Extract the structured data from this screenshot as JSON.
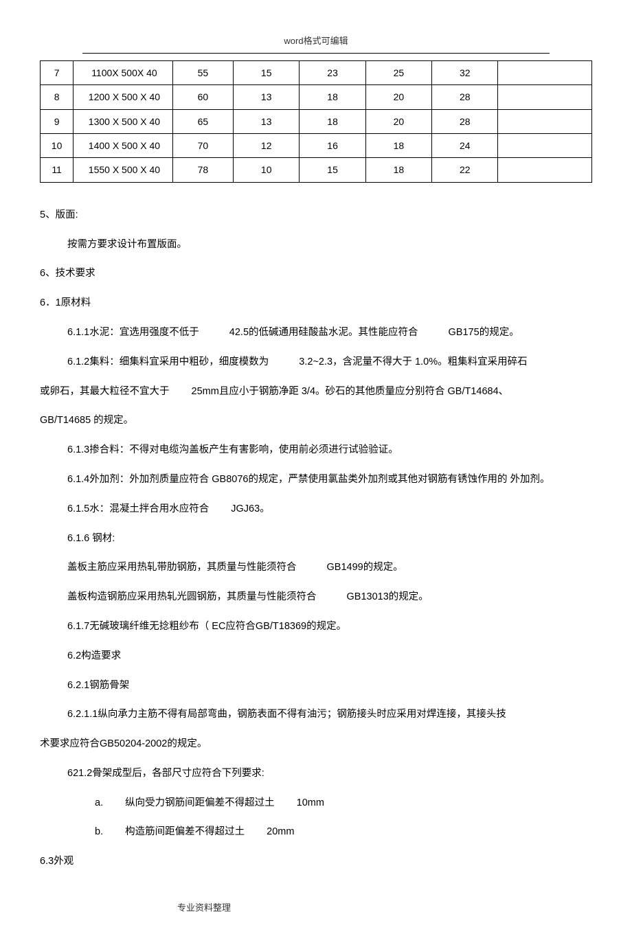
{
  "header": "word格式可编辑",
  "footer": "专业资料整理",
  "chart_data": {
    "type": "table",
    "rows": [
      {
        "idx": "7",
        "dim": "1100X 500X 40",
        "c3": "55",
        "c4": "15",
        "c5": "23",
        "c6": "25",
        "c7": "32",
        "c8": ""
      },
      {
        "idx": "8",
        "dim": "1200 X 500 X 40",
        "c3": "60",
        "c4": "13",
        "c5": "18",
        "c6": "20",
        "c7": "28",
        "c8": ""
      },
      {
        "idx": "9",
        "dim": "1300 X 500 X 40",
        "c3": "65",
        "c4": "13",
        "c5": "18",
        "c6": "20",
        "c7": "28",
        "c8": ""
      },
      {
        "idx": "10",
        "dim": "1400 X 500 X 40",
        "c3": "70",
        "c4": "12",
        "c5": "16",
        "c6": "18",
        "c7": "24",
        "c8": ""
      },
      {
        "idx": "11",
        "dim": "1550 X 500 X 40",
        "c3": "78",
        "c4": "10",
        "c5": "15",
        "c6": "18",
        "c7": "22",
        "c8": ""
      }
    ]
  },
  "sections": {
    "s5_title": "5、版面:",
    "s5_p1": "按需方要求设计布置版面。",
    "s6_title": "6、技术要求",
    "s6_1_title": "6．1原材料",
    "s6_1_1_a": "6.1.1水泥：宜选用强度不低于",
    "s6_1_1_b": "42.5的低碱通用硅酸盐水泥。其性能应符合",
    "s6_1_1_c": "GB175的规定。",
    "s6_1_2_a": "6.1.2集料：细集料宜采用中粗砂，细度模数为",
    "s6_1_2_b": "3.2~2.3，含泥量不得大于 1.0%。粗集料宜采用碎石",
    "s6_1_2_c": "或卵石，其最大粒径不宜大于",
    "s6_1_2_d": "25mm且应小于钢筋净距 3/4。砂石的其他质量应分别符合 GB/T14684、",
    "s6_1_2_e": "GB/T14685 的规定。",
    "s6_1_3": "6.1.3掺合料：不得对电缆沟盖板产生有害影响，使用前必须进行试验验证。",
    "s6_1_4": "6.1.4外加剂：外加剂质量应符合 GB8076的规定，严禁使用氯盐类外加剂或其他对钢筋有锈蚀作用的 外加剂。",
    "s6_1_5_a": "6.1.5水：混凝土拌合用水应符合",
    "s6_1_5_b": "JGJ63。",
    "s6_1_6": "6.1.6 钢材:",
    "s6_1_6_p1a": "盖板主筋应采用热轧带肋钢筋，其质量与性能须符合",
    "s6_1_6_p1b": "GB1499的规定。",
    "s6_1_6_p2a": "盖板构造钢筋应采用热轧光圆钢筋，其质量与性能须符合",
    "s6_1_6_p2b": "GB13013的规定。",
    "s6_1_7": "6.1.7无碱玻璃纤维无捻粗纱布（ EC应符合GB/T18369的规定。",
    "s6_2": "6.2构造要求",
    "s6_2_1": "6.2.1钢筋骨架",
    "s6_2_1_1": "6.2.1.1纵向承力主筋不得有局部弯曲，钢筋表面不得有油污；钢筋接头时应采用对焊连接，其接头技",
    "s6_2_1_1b": "术要求应符合GB50204-2002的规定。",
    "s6_2_1_2": "621.2骨架成型后，各部尺寸应符合下列要求:",
    "list_a_label": "a.",
    "list_a_text": "纵向受力钢筋间距偏差不得超过土",
    "list_a_val": "10mm",
    "list_b_label": "b.",
    "list_b_text": "构造筋间距偏差不得超过土",
    "list_b_val": "20mm",
    "s6_3": "6.3外观"
  }
}
